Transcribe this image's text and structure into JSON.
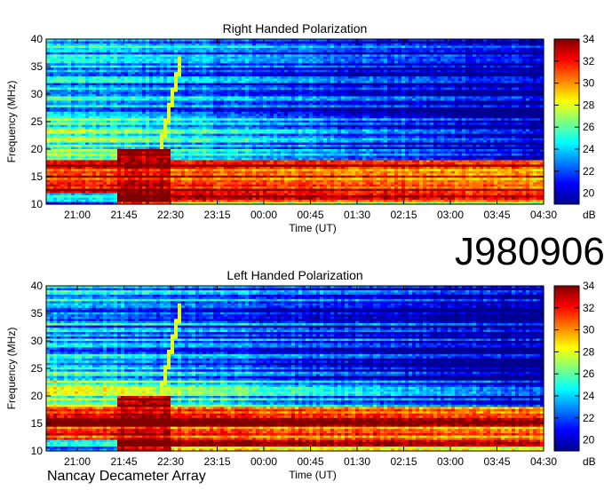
{
  "figure": {
    "observation_id": "J980906",
    "instrument": "Nancay Decameter Array"
  },
  "colors": {
    "colormap": [
      "#00008f",
      "#0000ff",
      "#0080ff",
      "#00ffff",
      "#80ff80",
      "#ffff00",
      "#ff8000",
      "#ff0000",
      "#800000"
    ]
  },
  "chart_data": [
    {
      "type": "heatmap",
      "title": "Right Handed Polarization",
      "xlabel": "Time (UT)",
      "ylabel": "Frequency (MHz)",
      "x_ticks": [
        "21:00",
        "21:45",
        "22:30",
        "23:15",
        "00:00",
        "00:45",
        "01:30",
        "02:15",
        "03:00",
        "03:45",
        "04:30"
      ],
      "y_ticks": [
        10,
        15,
        20,
        25,
        30,
        35,
        40
      ],
      "ylim": [
        10,
        40
      ],
      "colorbar": {
        "label": "dB",
        "ticks": [
          20,
          22,
          24,
          26,
          28,
          30,
          32,
          34
        ],
        "range": [
          19,
          34
        ]
      },
      "features": {
        "start_time": "20:30",
        "end_time": "04:30",
        "strong_emission_below_mhz": 18,
        "drifting_burst": {
          "time_start": "22:20",
          "time_end": "22:40",
          "freq_start_mhz": 20,
          "freq_end_mhz": 36
        }
      }
    },
    {
      "type": "heatmap",
      "title": "Left Handed Polarization",
      "xlabel": "Time (UT)",
      "ylabel": "Frequency (MHz)",
      "x_ticks": [
        "21:00",
        "21:45",
        "22:30",
        "23:15",
        "00:00",
        "00:45",
        "01:30",
        "02:15",
        "03:00",
        "03:45",
        "04:30"
      ],
      "y_ticks": [
        10,
        15,
        20,
        25,
        30,
        35,
        40
      ],
      "ylim": [
        10,
        40
      ],
      "colorbar": {
        "label": "dB",
        "ticks": [
          20,
          22,
          24,
          26,
          28,
          30,
          32,
          34
        ],
        "range": [
          19,
          34
        ]
      },
      "features": {
        "start_time": "20:30",
        "end_time": "04:30",
        "strong_emission_below_mhz": 18,
        "drifting_burst": {
          "time_start": "22:20",
          "time_end": "22:40",
          "freq_start_mhz": 20,
          "freq_end_mhz": 36
        }
      }
    }
  ]
}
